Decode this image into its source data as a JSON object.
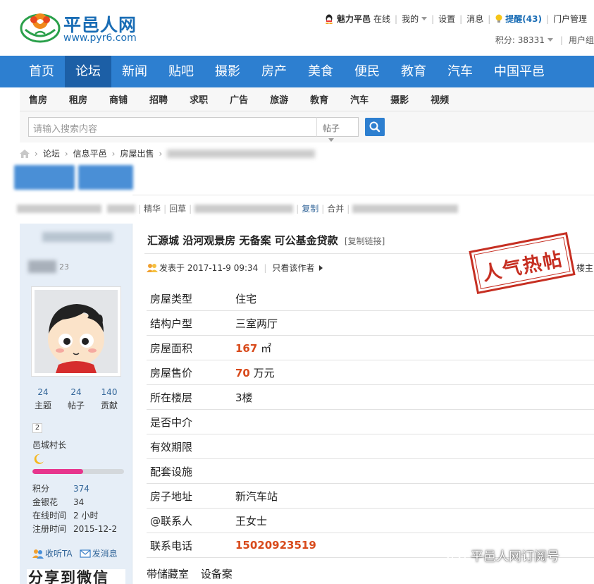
{
  "site": {
    "title": "平邑人网",
    "url": "www.pyr6.com"
  },
  "userbar": {
    "username": "魅力平邑",
    "status": "在线",
    "mine": "我的",
    "settings": "设置",
    "messages": "消息",
    "alerts": "提醒(43)",
    "portal_manage": "门户管理",
    "points": "积分: 38331",
    "user_group": "用户组"
  },
  "main_nav": [
    "首页",
    "论坛",
    "新闻",
    "贴吧",
    "摄影",
    "房产",
    "美食",
    "便民",
    "教育",
    "汽车",
    "中国平邑"
  ],
  "main_nav_active_index": 1,
  "sub_nav": [
    "售房",
    "租房",
    "商铺",
    "招聘",
    "求职",
    "广告",
    "旅游",
    "教育",
    "汽车",
    "摄影",
    "视频"
  ],
  "search": {
    "placeholder": "请输入搜索内容",
    "scope": "帖子"
  },
  "breadcrumb": [
    "论坛",
    "信息平邑",
    "房屋出售"
  ],
  "toolbar": {
    "items": [
      "精华",
      "回草",
      "复制",
      "合并"
    ]
  },
  "author": {
    "id_suffix": "23",
    "stats": [
      {
        "value": "24",
        "label": "主题"
      },
      {
        "value": "24",
        "label": "帖子"
      },
      {
        "value": "140",
        "label": "贡献"
      }
    ],
    "level": "2",
    "rank": "邑城村长",
    "progress": 0.55,
    "info": [
      {
        "key": "积分",
        "value": "374",
        "link": true
      },
      {
        "key": "金银花",
        "value": "34",
        "link": false
      },
      {
        "key": "在线时间",
        "value": "2 小时",
        "link": false
      },
      {
        "key": "注册时间",
        "value": "2015-12-2",
        "link": false
      }
    ],
    "actions": {
      "follow": "收听TA",
      "message": "发消息"
    },
    "share": "分享到微信"
  },
  "post": {
    "title": "汇源城 沿河观景房 无备案 可公基金贷款",
    "copy_link": "[复制链接]",
    "posted": "发表于 2017-11-9 09:34",
    "only_author": "只看该作者",
    "floor": "楼主",
    "stamp": "人气热帖",
    "details": [
      {
        "key": "房屋类型",
        "value": "住宅"
      },
      {
        "key": "结构户型",
        "value": "三室两厅"
      },
      {
        "key": "房屋面积",
        "value": "167",
        "unit": "㎡",
        "highlight": true
      },
      {
        "key": "房屋售价",
        "value": "70",
        "unit": "万元",
        "highlight": true
      },
      {
        "key": "所在楼层",
        "value": "3楼"
      },
      {
        "key": "是否中介",
        "value": ""
      },
      {
        "key": "有效期限",
        "value": ""
      },
      {
        "key": "配套设施",
        "value": ""
      },
      {
        "key": "房子地址",
        "value": "新汽车站"
      },
      {
        "key": "@联系人",
        "value": "王女士"
      },
      {
        "key": "联系电话",
        "value": "15020923519",
        "phone": true
      }
    ],
    "tags": [
      "带储藏室",
      "设备案"
    ]
  },
  "watermark": "平邑人网订阅号",
  "colors": {
    "brand_blue": "#2d7fd0",
    "nav_active": "#1c5fa6",
    "highlight_orange": "#d84a1b",
    "stamp_red": "#c62f22",
    "level_bar_pink": "#e7368d"
  }
}
